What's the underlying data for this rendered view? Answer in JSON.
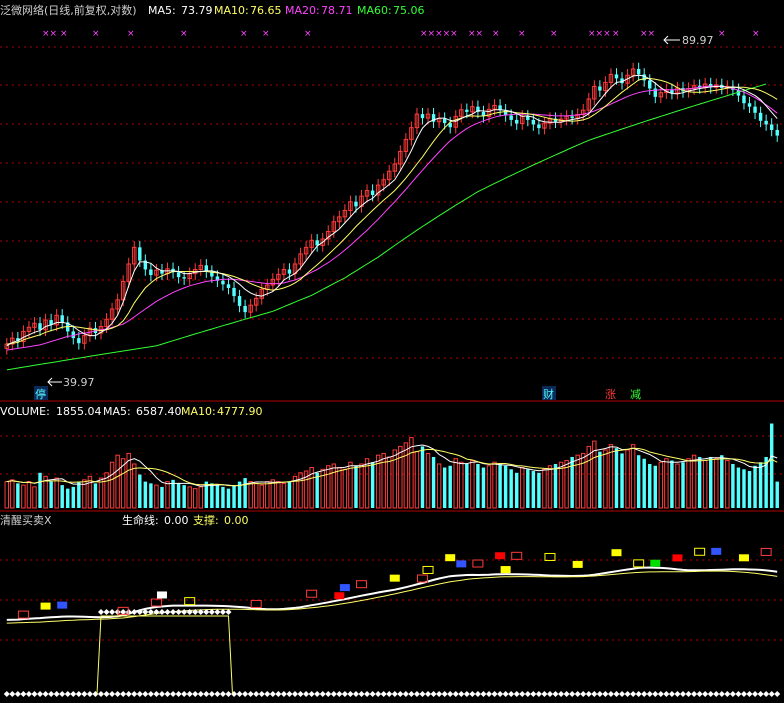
{
  "colors": {
    "background": "#000000",
    "up": "#ff3b3b",
    "down": "#54ffff",
    "grid": "#b00000",
    "ma5": "#ffffff",
    "ma10": "#ffff66",
    "ma20": "#ff44ff",
    "ma60": "#33ff33",
    "marker": "#ff44ff",
    "white": "#ffffff",
    "yellow": "#ffff00",
    "red_fill": "#ff0000",
    "green_fill": "#00dd00",
    "blue": "#3355ff",
    "cyan": "#00ffff"
  },
  "price_panel": {
    "title": "泛微网络(日线,前复权,对数)",
    "ma5_label": "MA5:",
    "ma5_value": "73.79",
    "ma10_label": "MA10:",
    "ma10_value": "76.65",
    "ma20_label": "MA20:",
    "ma20_value": "78.71",
    "ma60_label": "MA60:",
    "ma60_value": "75.06",
    "high_marker": "89.97",
    "low_marker": "39.97",
    "event_tags": [
      {
        "text": "停",
        "color": "#54ffff"
      },
      {
        "text": "财",
        "color": "#54ffff"
      },
      {
        "text": "涨",
        "color": "#ff3b3b"
      },
      {
        "text": "减",
        "color": "#33ff33"
      }
    ],
    "top_marks": [
      "××",
      "×",
      "×",
      "×",
      "×",
      "×",
      "×",
      "×",
      "×××××",
      "××",
      "×",
      "×",
      "×",
      "×××",
      "×",
      "××",
      "×",
      "×"
    ]
  },
  "volume_panel": {
    "label": "VOLUME:",
    "value": "1855.04",
    "ma5_label": "MA5:",
    "ma5_value": "6587.40",
    "ma10_label": "MA10:",
    "ma10_value": "4777.90"
  },
  "indicator_panel": {
    "name": "清醒买卖X",
    "line1_label": "生命线:",
    "line1_value": "0.00",
    "line2_label": "支撑:",
    "line2_value": "0.00"
  },
  "chart_data": {
    "type": "candlestick",
    "scale": "log",
    "n_bars": 140,
    "price_range": [
      36,
      100
    ],
    "close": [
      40.5,
      41.2,
      40.8,
      42.0,
      42.5,
      43.0,
      42.2,
      43.4,
      42.8,
      44.0,
      43.1,
      42.0,
      41.2,
      40.6,
      41.5,
      42.4,
      41.8,
      42.6,
      43.5,
      44.8,
      46.0,
      48.5,
      51.0,
      53.5,
      51.5,
      50.2,
      49.4,
      50.1,
      49.6,
      50.3,
      49.8,
      49.1,
      48.9,
      49.6,
      50.2,
      50.8,
      49.9,
      49.2,
      48.6,
      48.1,
      47.6,
      46.5,
      45.2,
      44.4,
      45.3,
      46.2,
      47.4,
      48.0,
      48.8,
      49.5,
      50.2,
      49.6,
      51.0,
      52.5,
      53.5,
      54.6,
      53.8,
      54.8,
      56.0,
      57.6,
      58.4,
      59.5,
      61.0,
      60.2,
      62.0,
      63.0,
      62.2,
      64.0,
      65.0,
      66.6,
      68.0,
      70.5,
      73.0,
      75.5,
      78.5,
      77.6,
      78.5,
      76.8,
      77.5,
      76.5,
      75.6,
      78.0,
      79.5,
      79.0,
      80.2,
      79.0,
      78.0,
      79.6,
      80.5,
      79.4,
      78.2,
      77.2,
      76.4,
      78.0,
      77.2,
      76.2,
      75.4,
      76.5,
      77.5,
      76.8,
      77.4,
      78.0,
      77.6,
      78.4,
      79.4,
      82.0,
      85.0,
      84.0,
      86.0,
      88.0,
      87.0,
      85.8,
      87.8,
      89.4,
      88.0,
      86.5,
      84.5,
      82.5,
      83.5,
      84.2,
      83.4,
      84.6,
      83.8,
      84.5,
      85.2,
      84.8,
      85.6,
      84.8,
      85.4,
      84.6,
      85.0,
      84.2,
      82.8,
      81.0,
      80.2,
      78.8,
      77.0,
      76.2,
      75.0,
      73.8
    ],
    "open": [
      40.0,
      40.5,
      41.2,
      40.8,
      42.0,
      42.5,
      43.0,
      42.2,
      43.4,
      42.8,
      44.0,
      43.1,
      42.0,
      41.2,
      40.6,
      41.5,
      42.4,
      41.8,
      42.6,
      43.5,
      44.8,
      46.0,
      48.5,
      51.0,
      53.5,
      51.5,
      50.2,
      49.4,
      50.1,
      49.6,
      50.3,
      49.8,
      49.1,
      48.9,
      49.6,
      50.2,
      50.8,
      49.9,
      49.2,
      48.6,
      48.1,
      47.6,
      46.5,
      45.2,
      44.4,
      45.3,
      46.2,
      47.4,
      48.0,
      48.8,
      49.5,
      50.2,
      49.6,
      51.0,
      52.5,
      53.5,
      54.6,
      53.8,
      54.8,
      56.0,
      57.6,
      58.4,
      59.5,
      61.0,
      60.2,
      62.0,
      63.0,
      62.2,
      64.0,
      65.0,
      66.6,
      68.0,
      70.5,
      73.0,
      75.5,
      78.5,
      77.6,
      78.5,
      76.8,
      77.5,
      76.5,
      75.6,
      78.0,
      79.5,
      79.0,
      80.2,
      79.0,
      78.0,
      79.6,
      80.5,
      79.4,
      78.2,
      77.2,
      76.4,
      78.0,
      77.2,
      76.2,
      75.4,
      76.5,
      77.5,
      76.8,
      77.4,
      78.0,
      77.6,
      78.4,
      79.4,
      82.0,
      85.0,
      84.0,
      86.0,
      88.0,
      87.0,
      85.8,
      87.8,
      89.4,
      88.0,
      86.5,
      84.5,
      82.5,
      83.5,
      84.2,
      83.4,
      84.6,
      83.8,
      84.5,
      85.2,
      84.8,
      85.6,
      84.8,
      85.4,
      84.6,
      85.0,
      84.2,
      82.8,
      81.0,
      80.2,
      78.8,
      77.0,
      76.2,
      75.0
    ],
    "ma5": [
      40.3,
      40.7,
      40.9,
      41.3,
      41.6,
      41.9,
      42.1,
      42.6,
      42.8,
      43.1,
      43.1,
      43.0,
      42.6,
      42.1,
      41.7,
      41.5,
      41.5,
      41.9,
      42.3,
      43.0,
      44.0,
      45.7,
      47.9,
      50.0,
      51.3,
      51.3,
      51.1,
      50.4,
      50.0,
      50.0,
      50.0,
      49.9,
      49.6,
      49.6,
      49.8,
      49.9,
      50.0,
      50.0,
      49.8,
      49.5,
      49.2,
      48.7,
      48.1,
      47.4,
      46.9,
      46.6,
      46.5,
      46.8,
      47.1,
      47.8,
      48.7,
      49.2,
      49.6,
      50.4,
      51.5,
      52.6,
      53.7,
      54.3,
      55.1,
      55.7,
      56.4,
      57.4,
      58.4,
      59.5,
      60.3,
      61.1,
      61.6,
      62.6,
      63.3,
      64.1,
      65.0,
      66.7,
      68.6,
      70.7,
      73.2,
      75.4,
      76.6,
      77.2,
      77.6,
      77.6,
      77.1,
      76.9,
      77.5,
      78.1,
      78.5,
      79.3,
      79.2,
      79.1,
      79.5,
      79.5,
      79.4,
      79.1,
      78.6,
      78.0,
      78.1,
      77.8,
      77.1,
      76.8,
      76.7,
      76.7,
      76.7,
      77.0,
      77.3,
      77.5,
      77.8,
      78.6,
      80.1,
      81.7,
      83.3,
      84.8,
      86.0,
      86.2,
      86.9,
      87.6,
      87.8,
      87.6,
      86.8,
      85.8,
      84.7,
      83.8,
      83.3,
      83.2,
      83.5,
      83.9,
      84.2,
      84.5,
      84.7,
      84.9,
      85.0,
      85.1,
      84.8,
      84.9,
      84.7,
      84.2,
      83.5,
      82.8,
      81.8,
      80.4,
      78.9,
      77.5
    ],
    "ma10": [
      40.5,
      40.6,
      40.7,
      41.0,
      41.2,
      41.4,
      41.6,
      41.9,
      42.1,
      42.3,
      42.5,
      42.6,
      42.6,
      42.5,
      42.4,
      42.3,
      42.2,
      42.1,
      42.2,
      42.4,
      42.7,
      43.3,
      44.3,
      45.6,
      46.6,
      47.6,
      48.3,
      48.9,
      49.3,
      49.6,
      49.9,
      49.9,
      49.9,
      49.9,
      49.9,
      49.9,
      49.9,
      49.8,
      49.7,
      49.6,
      49.4,
      49.2,
      48.9,
      48.6,
      48.2,
      47.9,
      47.6,
      47.4,
      47.3,
      47.4,
      47.6,
      47.9,
      48.3,
      48.8,
      49.5,
      50.2,
      50.9,
      51.6,
      52.4,
      53.2,
      54.0,
      54.9,
      55.8,
      56.8,
      57.7,
      58.6,
      59.5,
      60.4,
      61.3,
      62.1,
      63.0,
      64.1,
      65.3,
      66.6,
      68.0,
      69.4,
      71.0,
      72.6,
      74.1,
      75.5,
      76.7,
      77.2,
      77.6,
      78.0,
      78.1,
      78.0,
      78.1,
      78.3,
      78.7,
      78.9,
      79.1,
      79.0,
      78.8,
      78.7,
      78.6,
      78.4,
      78.1,
      77.8,
      77.5,
      77.3,
      77.1,
      77.0,
      76.9,
      77.0,
      77.2,
      77.6,
      78.4,
      79.3,
      80.3,
      81.4,
      82.5,
      83.6,
      84.6,
      85.6,
      86.6,
      86.9,
      87.0,
      86.8,
      86.5,
      86.1,
      85.5,
      84.7,
      84.1,
      83.7,
      83.6,
      83.6,
      83.7,
      83.9,
      84.1,
      84.3,
      84.6,
      84.8,
      84.8,
      84.8,
      84.6,
      84.4,
      84.0,
      83.4,
      82.7,
      81.9
    ],
    "ma20": [
      39.8,
      39.9,
      40.0,
      40.1,
      40.2,
      40.3,
      40.4,
      40.6,
      40.8,
      41.0,
      41.2,
      41.4,
      41.5,
      41.7,
      41.8,
      41.9,
      42.1,
      42.2,
      42.3,
      42.5,
      42.7,
      42.9,
      43.3,
      43.8,
      44.3,
      44.8,
      45.3,
      45.8,
      46.2,
      46.6,
      47.0,
      47.3,
      47.6,
      47.9,
      48.1,
      48.3,
      48.5,
      48.6,
      48.7,
      48.8,
      48.8,
      48.8,
      48.7,
      48.6,
      48.5,
      48.4,
      48.3,
      48.2,
      48.2,
      48.2,
      48.3,
      48.5,
      48.7,
      49.0,
      49.4,
      49.8,
      50.2,
      50.7,
      51.2,
      51.8,
      52.4,
      53.1,
      53.8,
      54.6,
      55.4,
      56.2,
      57.1,
      58.0,
      59.0,
      60.0,
      61.0,
      62.1,
      63.2,
      64.4,
      65.6,
      66.8,
      68.0,
      69.2,
      70.4,
      71.6,
      72.7,
      73.6,
      74.5,
      75.3,
      76.0,
      76.5,
      77.0,
      77.4,
      77.8,
      78.1,
      78.3,
      78.4,
      78.5,
      78.5,
      78.5,
      78.5,
      78.4,
      78.3,
      78.2,
      78.1,
      78.1,
      78.1,
      78.2,
      78.3,
      78.5,
      78.8,
      79.2,
      79.7,
      80.2,
      80.8,
      81.4,
      82.0,
      82.6,
      83.1,
      83.5,
      83.8,
      84.0,
      84.1,
      84.2,
      84.2,
      84.2,
      84.2,
      84.3,
      84.4,
      84.6,
      84.8,
      85.0,
      85.1,
      85.1,
      85.0,
      84.8,
      84.5,
      84.1,
      83.6,
      83.0,
      82.3,
      81.5,
      80.6,
      79.7,
      78.7
    ],
    "ma60": [
      37.6,
      37.7,
      37.8,
      37.9,
      38.0,
      38.1,
      38.2,
      38.3,
      38.4,
      38.5,
      38.6,
      38.7,
      38.8,
      38.9,
      39.0,
      39.1,
      39.2,
      39.3,
      39.4,
      39.5,
      39.6,
      39.7,
      39.8,
      39.9,
      40.0,
      40.1,
      40.2,
      40.3,
      40.5,
      40.7,
      40.9,
      41.1,
      41.3,
      41.5,
      41.7,
      41.9,
      42.1,
      42.3,
      42.5,
      42.7,
      42.9,
      43.1,
      43.3,
      43.5,
      43.7,
      43.9,
      44.1,
      44.3,
      44.5,
      44.8,
      45.1,
      45.4,
      45.7,
      46.0,
      46.3,
      46.6,
      47.0,
      47.4,
      47.8,
      48.2,
      48.6,
      49.0,
      49.5,
      50.0,
      50.5,
      51.0,
      51.5,
      52.0,
      52.6,
      53.2,
      53.8,
      54.4,
      55.0,
      55.6,
      56.2,
      56.8,
      57.4,
      58.0,
      58.6,
      59.2,
      59.8,
      60.4,
      61.0,
      61.6,
      62.2,
      62.8,
      63.3,
      63.8,
      64.3,
      64.8,
      65.3,
      65.8,
      66.3,
      66.8,
      67.3,
      67.8,
      68.3,
      68.8,
      69.3,
      69.8,
      70.3,
      70.8,
      71.3,
      71.8,
      72.3,
      72.8,
      73.2,
      73.6,
      74.0,
      74.4,
      74.8,
      75.2,
      75.6,
      76.0,
      76.4,
      76.8,
      77.2,
      77.6,
      78.0,
      78.4,
      78.8,
      79.2,
      79.6,
      80.0,
      80.4,
      80.8,
      81.2,
      81.6,
      82.0,
      82.4,
      82.8,
      83.2,
      83.6,
      84.0,
      84.4,
      84.8,
      85.2,
      85.6
    ],
    "volume": [
      30,
      32,
      28,
      26,
      30,
      24,
      40,
      36,
      30,
      34,
      26,
      22,
      24,
      30,
      32,
      36,
      28,
      34,
      40,
      52,
      60,
      56,
      62,
      50,
      38,
      30,
      28,
      26,
      24,
      30,
      32,
      28,
      26,
      24,
      22,
      24,
      30,
      28,
      26,
      24,
      22,
      26,
      30,
      34,
      30,
      28,
      26,
      30,
      32,
      30,
      28,
      30,
      36,
      40,
      42,
      46,
      40,
      44,
      48,
      50,
      46,
      44,
      52,
      48,
      50,
      56,
      52,
      60,
      62,
      58,
      66,
      70,
      74,
      80,
      64,
      70,
      62,
      58,
      50,
      46,
      48,
      56,
      52,
      50,
      54,
      50,
      46,
      48,
      52,
      50,
      48,
      44,
      40,
      46,
      44,
      42,
      40,
      44,
      48,
      50,
      52,
      54,
      58,
      60,
      62,
      70,
      76,
      64,
      66,
      72,
      68,
      62,
      66,
      72,
      60,
      56,
      50,
      48,
      52,
      56,
      54,
      50,
      52,
      56,
      60,
      58,
      54,
      58,
      56,
      60,
      54,
      50,
      46,
      44,
      42,
      48,
      52,
      58,
      96,
      30
    ],
    "ylim_volume": [
      0,
      100
    ]
  }
}
